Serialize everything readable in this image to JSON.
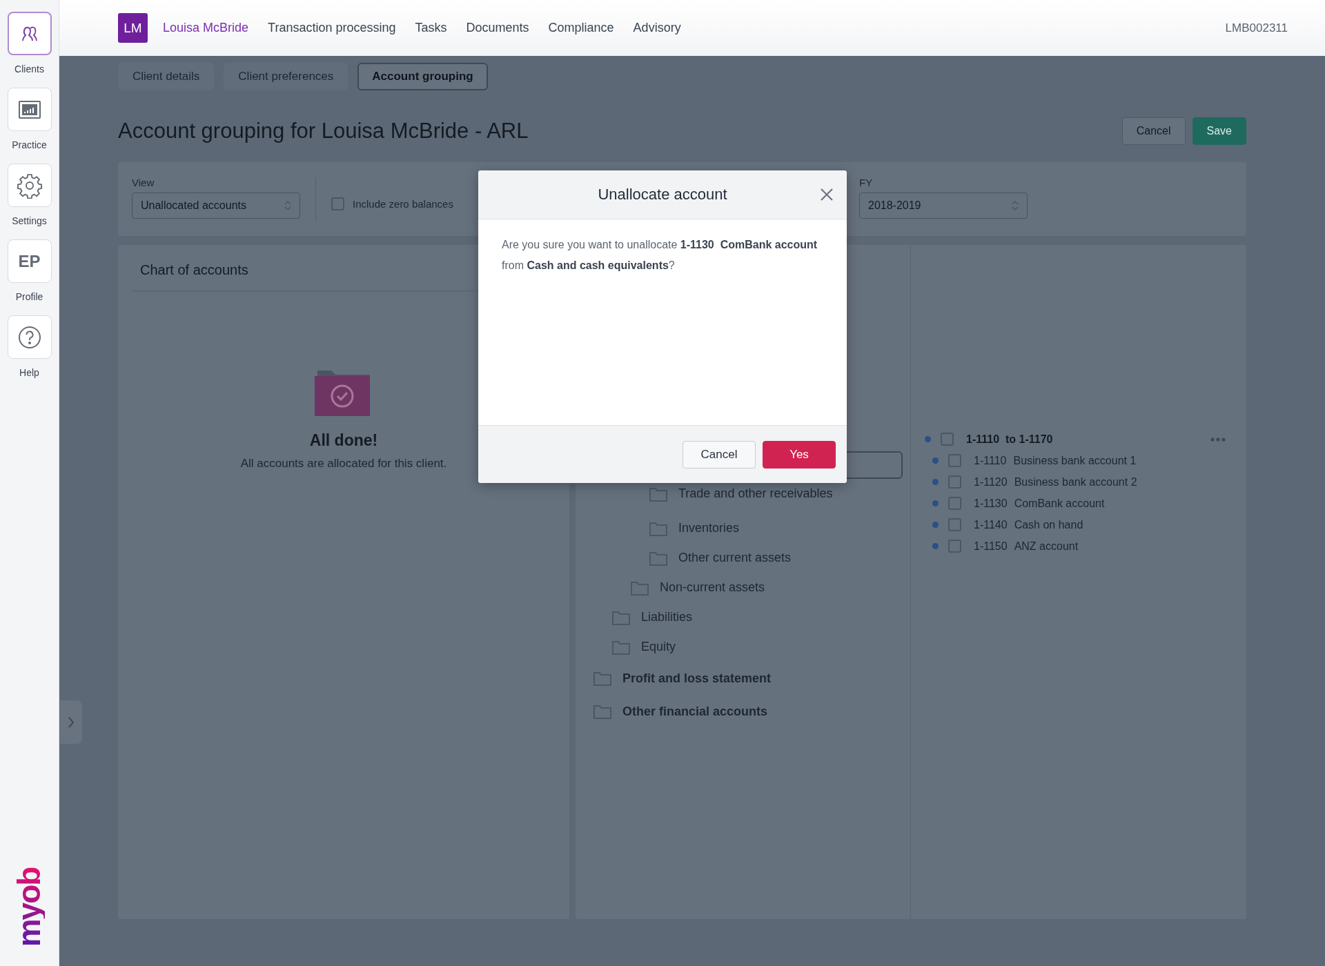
{
  "sidebar": {
    "items": [
      {
        "label": "Clients",
        "kind": "clients",
        "selected": true
      },
      {
        "label": "Practice",
        "kind": "chart",
        "selected": false
      },
      {
        "label": "Settings",
        "kind": "gear",
        "selected": false
      },
      {
        "label": "Profile",
        "kind": "initials",
        "initials": "EP",
        "selected": false
      },
      {
        "label": "Help",
        "kind": "help",
        "selected": false
      }
    ],
    "logo": "myob"
  },
  "header": {
    "avatar": "LM",
    "client_name": "Louisa McBride",
    "nav": [
      "Transaction processing",
      "Tasks",
      "Documents",
      "Compliance",
      "Advisory"
    ],
    "client_code": "LMB002311"
  },
  "tabs": [
    {
      "label": "Client details",
      "selected": false
    },
    {
      "label": "Client preferences",
      "selected": false
    },
    {
      "label": "Account grouping",
      "selected": true
    }
  ],
  "page": {
    "title": "Account grouping for Louisa McBride - ARL",
    "buttons": [
      {
        "label": "Cancel",
        "kind": "secondary"
      },
      {
        "label": "Save",
        "kind": "primary"
      }
    ]
  },
  "filters": {
    "view": {
      "label": "View",
      "value": "Unallocated accounts"
    },
    "include_zero_balances": {
      "label": "Include zero balances",
      "checked": false
    },
    "fy": {
      "label": "FY",
      "value": "2018-2019"
    }
  },
  "chart_of_accounts": {
    "title": "Chart of accounts",
    "empty_state": {
      "heading": "All done!",
      "message": "All accounts are allocated for this client."
    }
  },
  "groups_tree": [
    {
      "children": [
        {
          "children": [
            {
              "children": [
                {
                  "label": "Trade and other receivables"
                },
                {
                  "label": "Inventories"
                },
                {
                  "label": "Other current assets"
                }
              ]
            },
            {
              "label": "Non-current assets"
            }
          ]
        },
        {
          "label": "Liabilities"
        },
        {
          "label": "Equity"
        }
      ]
    },
    {
      "label": "Profit and loss statement"
    },
    {
      "label": "Other financial accounts"
    }
  ],
  "account_group": {
    "label": "1-1110  to 1-1170",
    "checked": false,
    "accounts": [
      {
        "code": "1-1110",
        "name": "Business bank account 1",
        "checked": false
      },
      {
        "code": "1-1120",
        "name": "Business bank account 2",
        "checked": false
      },
      {
        "code": "1-1130",
        "name": "ComBank account",
        "checked": false
      },
      {
        "code": "1-1140",
        "name": "Cash on hand",
        "checked": false
      },
      {
        "code": "1-1150",
        "name": "ANZ account",
        "checked": false
      }
    ]
  },
  "modal": {
    "title": "Unallocate account",
    "message": "Are you sure you want to unallocate **1-1130  ComBank account** from **Cash and cash equivalents**?",
    "buttons": [
      {
        "label": "Cancel",
        "kind": "secondary"
      },
      {
        "label": "Yes",
        "kind": "danger"
      }
    ]
  }
}
